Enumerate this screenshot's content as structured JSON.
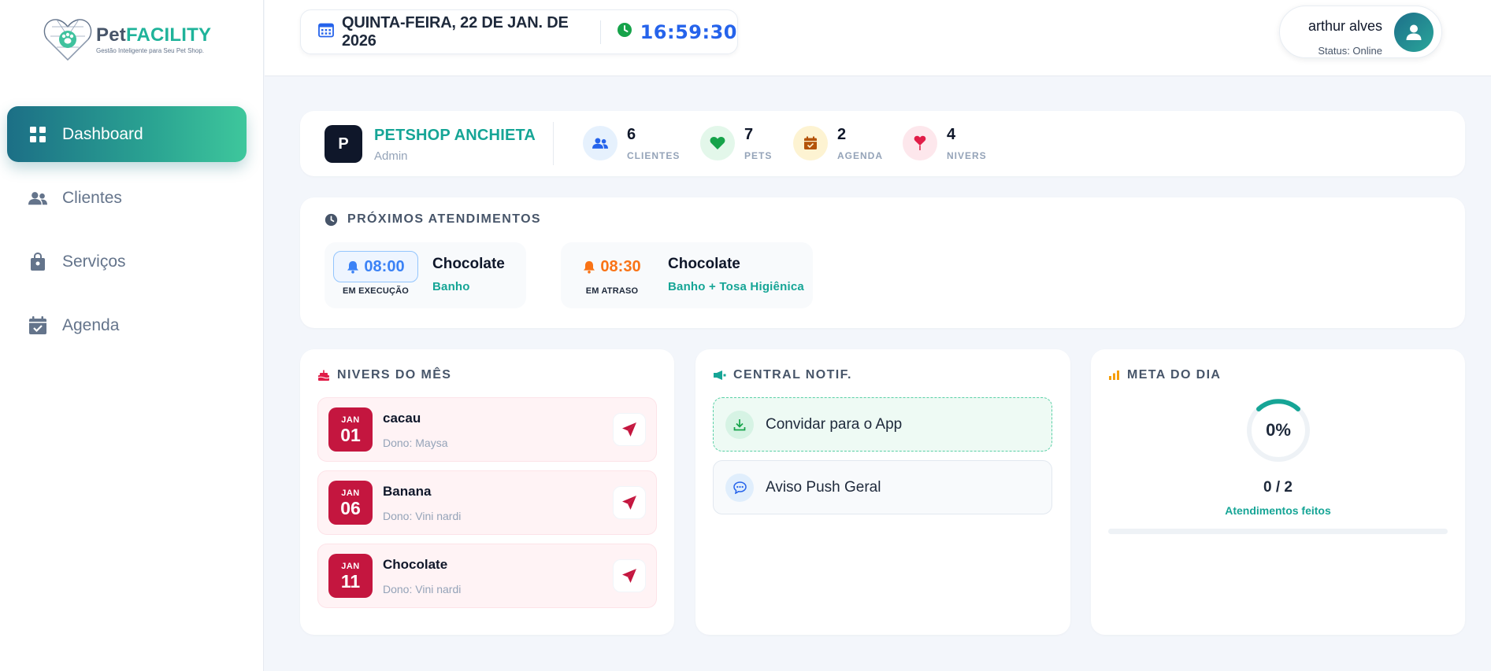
{
  "app": {
    "logo_title_a": "Pet",
    "logo_title_b": "FACILITY",
    "logo_subtitle": "Gestão Inteligente para Seu Pet Shop."
  },
  "sidebar": {
    "items": [
      {
        "label": "Dashboard",
        "icon": "grid-icon",
        "active": true
      },
      {
        "label": "Clientes",
        "icon": "users-icon",
        "active": false
      },
      {
        "label": "Serviços",
        "icon": "bag-icon",
        "active": false
      },
      {
        "label": "Agenda",
        "icon": "calendar-check-icon",
        "active": false
      }
    ]
  },
  "header": {
    "date": "QUINTA-FEIRA, 22 DE JAN. DE 2026",
    "time": "16:59:30",
    "user_name": "arthur alves",
    "user_status": "Status: Online"
  },
  "shop": {
    "badge": "P",
    "name": "PETSHOP ANCHIETA",
    "role": "Admin"
  },
  "stats": [
    {
      "value": "6",
      "label": "CLIENTES",
      "icon": "users-icon",
      "color": "#3b82f6",
      "bg": "#e6f1fd"
    },
    {
      "value": "7",
      "label": "PETS",
      "icon": "heart-icon",
      "color": "#16a34a",
      "bg": "#e3f7ea"
    },
    {
      "value": "2",
      "label": "AGENDA",
      "icon": "calendar-icon",
      "color": "#b45309",
      "bg": "#fdf3d2"
    },
    {
      "value": "4",
      "label": "NIVERS",
      "icon": "balloon-icon",
      "color": "#e11d48",
      "bg": "#fde7ec"
    }
  ],
  "next_appointments": {
    "title": "PRÓXIMOS ATENDIMENTOS",
    "items": [
      {
        "time": "08:00",
        "status": "EM EXECUÇÃO",
        "pet": "Chocolate",
        "service": "Banho",
        "color": "#3b82f6",
        "pill_bg": "#eef5ff",
        "pill_border": "#93c5fd"
      },
      {
        "time": "08:30",
        "status": "EM ATRASO",
        "pet": "Chocolate",
        "service": "Banho + Tosa Higiênica",
        "color": "#f97316",
        "pill_bg": "transparent",
        "pill_border": "transparent"
      }
    ]
  },
  "nivers": {
    "title": "NIVERS DO MÊS",
    "items": [
      {
        "month": "JAN",
        "day": "01",
        "name": "cacau",
        "owner": "Dono: Maysa"
      },
      {
        "month": "JAN",
        "day": "06",
        "name": "Banana",
        "owner": "Dono: Vini nardi"
      },
      {
        "month": "JAN",
        "day": "11",
        "name": "Chocolate",
        "owner": "Dono: Vini nardi"
      }
    ]
  },
  "central": {
    "title": "CENTRAL NOTIF.",
    "invite_label": "Convidar para o App",
    "push_label": "Aviso Push Geral"
  },
  "meta": {
    "title": "META DO DIA",
    "percent_label": "0%",
    "progress_fraction": 0,
    "count": "0 / 2",
    "caption": "Atendimentos feitos"
  },
  "colors": {
    "accent": "#16a596",
    "primary_text": "#0f172a",
    "muted": "#94a3b8",
    "bday_red": "#c4163f"
  }
}
